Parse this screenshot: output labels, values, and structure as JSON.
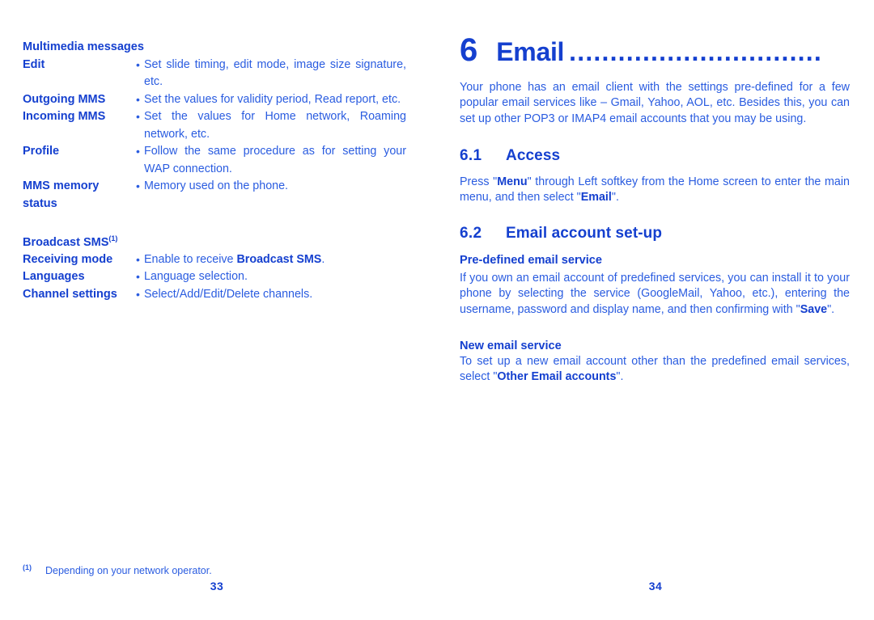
{
  "document": {
    "type": "user-manual-spread",
    "ink_color": "#1540cf",
    "body_color": "#2a5ce0",
    "background": "#ffffff"
  },
  "left_page": {
    "folio": "33",
    "groups": [
      {
        "title": "Multimedia messages",
        "rows": [
          {
            "label": "Edit",
            "bullet": "•",
            "desc": "Set slide timing, edit mode, image size signature, etc."
          },
          {
            "label": "Outgoing MMS",
            "bullet": "•",
            "desc": "Set the values for validity period, Read report, etc."
          },
          {
            "label": "Incoming MMS",
            "bullet": "•",
            "desc": "Set the values for Home network, Roaming network, etc."
          },
          {
            "label": "Profile",
            "bullet": "•",
            "desc": "Follow the same procedure as for setting your WAP connection."
          },
          {
            "label": "MMS memory status",
            "bullet": "•",
            "desc": "Memory used on the phone."
          }
        ]
      },
      {
        "title": "Broadcast SMS",
        "title_footnote": "(1)",
        "rows": [
          {
            "label": "Receiving mode",
            "bullet": "•",
            "desc_pre": "Enable to receive ",
            "desc_bold": "Broadcast SMS",
            "desc_post": "."
          },
          {
            "label": "Languages",
            "bullet": "•",
            "desc": "Language selection."
          },
          {
            "label": "Channel settings",
            "bullet": "•",
            "desc": "Select/Add/Edit/Delete channels."
          }
        ]
      }
    ],
    "footnote": {
      "mark": "(1)",
      "text": "Depending on your network operator."
    }
  },
  "right_page": {
    "folio": "34",
    "chapter": {
      "number": "6",
      "title": "Email",
      "leader": "..............................."
    },
    "intro": "Your phone has an email client with the settings pre-defined for a few popular email services like – Gmail, Yahoo, AOL, etc. Besides this, you can set up other POP3 or IMAP4 email accounts that you may be using.",
    "sections": [
      {
        "number": "6.1",
        "title": "Access",
        "body_pre": "Press \"",
        "body_bold1": "Menu",
        "body_mid": "\" through Left softkey from the Home screen to enter the main menu, and then select \"",
        "body_bold2": "Email",
        "body_post": "\"."
      },
      {
        "number": "6.2",
        "title": "Email account set-up",
        "subsections": [
          {
            "heading": "Pre-defined email service",
            "body_pre": "If you own an email account of predefined services, you can install it to your phone by selecting the service (GoogleMail, Yahoo, etc.), entering the username, password and display name, and then confirming with \"",
            "body_bold": "Save",
            "body_post": "\"."
          },
          {
            "heading": "New email service",
            "body_pre": "To set up a new email account other than the predefined email services, select \"",
            "body_bold": "Other Email accounts",
            "body_post": "\"."
          }
        ]
      }
    ]
  }
}
